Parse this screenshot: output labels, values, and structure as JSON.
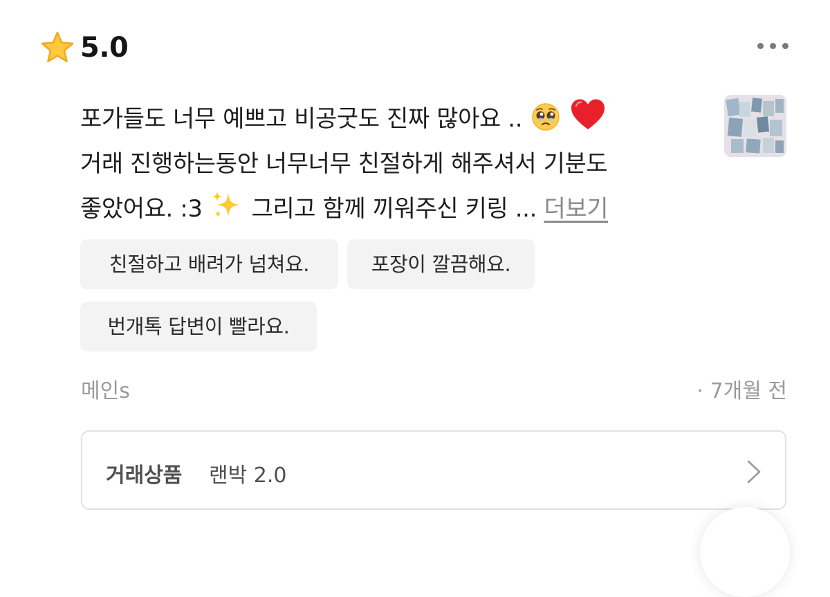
{
  "rating": {
    "value": "5.0"
  },
  "review": {
    "lines": [
      "포가들도 너무 예쁘고 비공굿도 진짜 많아요 ..",
      "거래 진행하는동안 너무너무 친절하게 해주셔서 기분도",
      "좋았어요. :3",
      "그리고 함께 끼워주신 키링 ..."
    ],
    "more_label": "더보기"
  },
  "tags": [
    "친절하고 배려가 넘쳐요.",
    "포장이 깔끔해요.",
    "번개톡 답변이 빨라요."
  ],
  "reviewer": "메인s",
  "time": "· 7개월 전",
  "product": {
    "label": "거래상품",
    "name": "랜박 2.0"
  },
  "icons": [
    "star-icon",
    "more-options-icon",
    "pleading-face-emoji",
    "red-heart-emoji",
    "sparkles-emoji",
    "chevron-right-icon"
  ],
  "colors": {
    "star": "#FFC83D",
    "heart": "#E8202A",
    "tag_bg": "#F3F3F3",
    "muted_text": "#9A9A9A"
  }
}
